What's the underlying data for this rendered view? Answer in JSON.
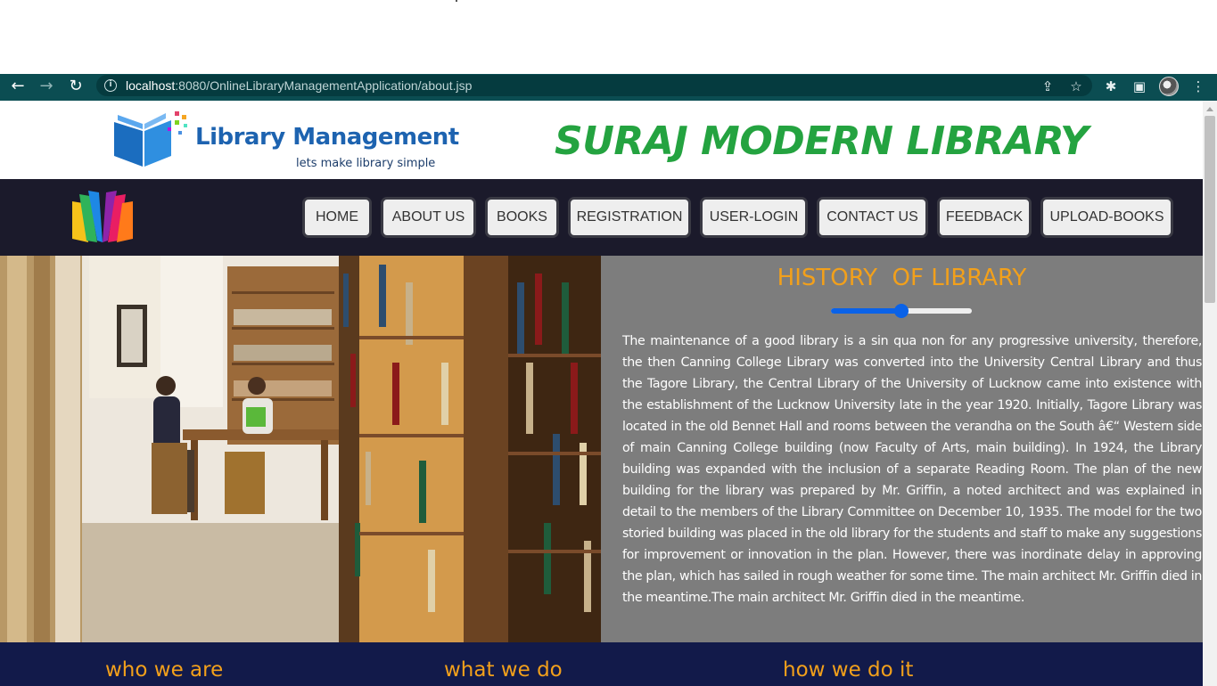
{
  "browser": {
    "url_host": "localhost",
    "url_rest": ":8080/OnlineLibraryManagementApplication/about.jsp"
  },
  "header": {
    "logo_title": "Library Management",
    "logo_tagline": "lets make library simple",
    "site_title": "SURAJ MODERN LIBRARY"
  },
  "nav": {
    "items": [
      {
        "label": "HOME"
      },
      {
        "label": "ABOUT US"
      },
      {
        "label": "BOOKS"
      },
      {
        "label": "REGISTRATION"
      },
      {
        "label": "USER-LOGIN"
      },
      {
        "label": "CONTACT US"
      },
      {
        "label": "FEEDBACK"
      },
      {
        "label": "UPLOAD-BOOKS"
      }
    ]
  },
  "history": {
    "title": "HISTORY  OF LIBRARY",
    "slider_value_fraction": 0.5,
    "text": "The maintenance of a good library is a sin qua non for any progressive university, therefore, the then Canning College Library was converted into the University Central Library and thus the Tagore Library, the Central Library of the University of Lucknow came into existence with the establishment of the Lucknow University late in the year 1920. Initially, Tagore Library was located in the old Bennet Hall and rooms between the verandha on the South â€“ Western side of main Canning College building (now Faculty of Arts, main building). In 1924, the Library building was expanded with the inclusion of a separate Reading Room. The plan of the new building for the library was prepared by Mr. Griffin, a noted architect and was explained in detail to the members of the Library Committee on December 10, 1935. The model for the two storied building was placed in the old library for the students and staff to make any suggestions for improvement or innovation in the plan. However, there was inordinate delay in approving the plan, which has sailed in rough weather for some time. The main architect Mr. Griffin died in the meantime.The main architect Mr. Griffin died in the meantime."
  },
  "sections": {
    "who": "who we are",
    "what": "what we do",
    "how": "how we do it"
  },
  "colors": {
    "chrome": "#0b4d52",
    "navbar": "#1b1a2b",
    "site_title": "#24a340",
    "accent_orange": "#f2a01b",
    "history_bg": "#7d7d7d",
    "footer_bg": "#121a4a"
  }
}
